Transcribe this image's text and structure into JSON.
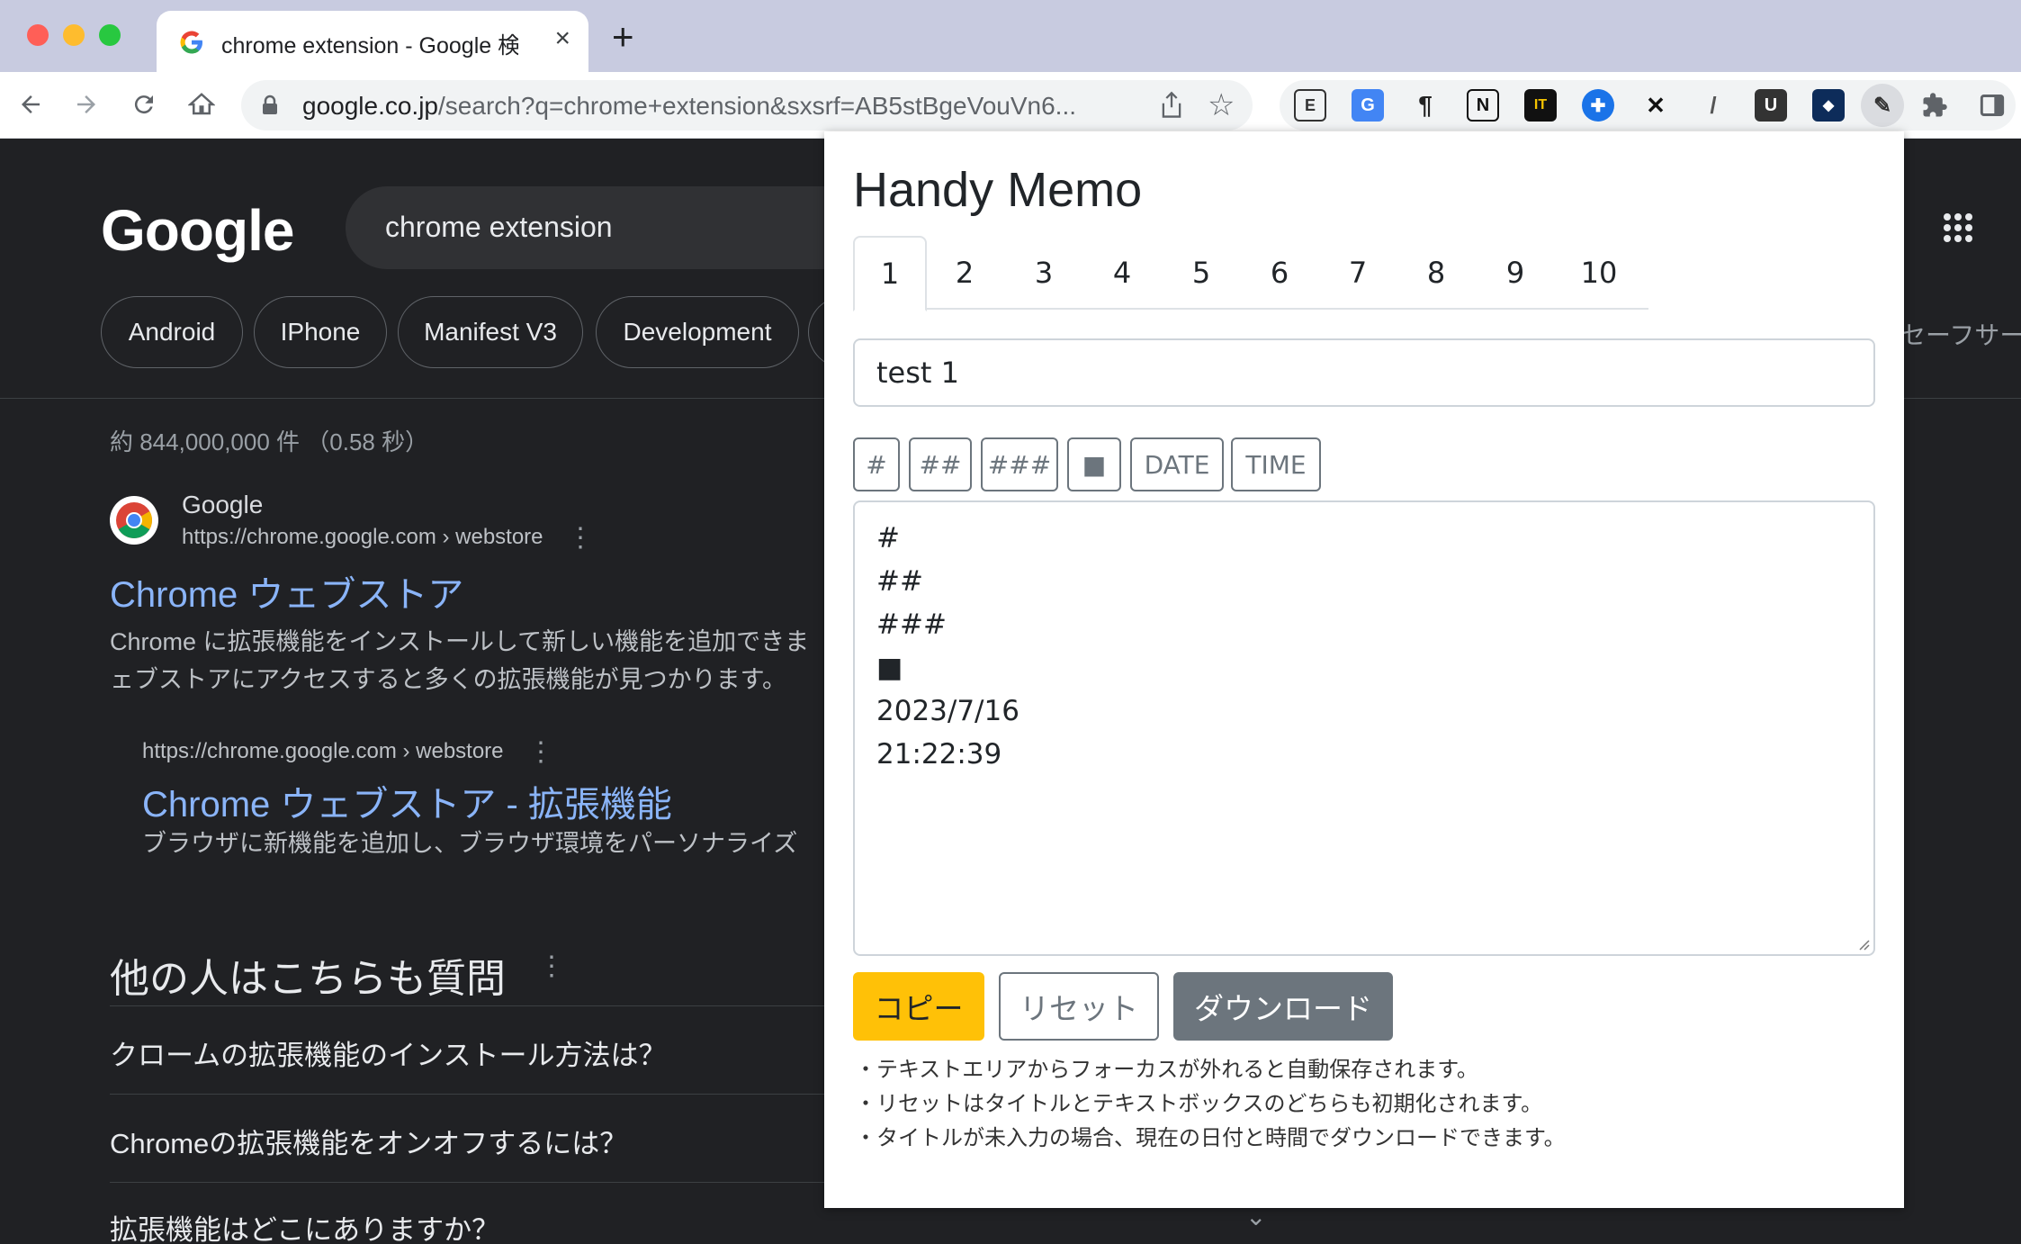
{
  "browser": {
    "tab_title": "chrome extension - Google 検索",
    "tab_close": "×",
    "new_tab": "+",
    "url_host": "google.co.jp",
    "url_rest": "/search?q=chrome+extension&sxsrf=AB5stBgeVouVn6...",
    "extensions": [
      "E",
      "G",
      "¶",
      "N",
      "IT",
      "✚",
      "✕",
      "/",
      "U",
      "◆",
      "✎",
      "puzzle"
    ]
  },
  "google": {
    "logo": "Google",
    "query": "chrome extension",
    "chips": [
      "Android",
      "IPhone",
      "Manifest V3",
      "Development"
    ],
    "safe_search": "セーフサー",
    "result_count": "約 844,000,000 件 （0.58 秒）",
    "result1": {
      "site": "Google",
      "url": "https://chrome.google.com › webstore",
      "title": "Chrome ウェブストア",
      "snippet_line1": "Chrome に拡張機能をインストールして新しい機能を追加できま",
      "snippet_line2": "ェブストアにアクセスすると多くの拡張機能が見つかります。"
    },
    "result2": {
      "url": "https://chrome.google.com › webstore",
      "title": "Chrome ウェブストア - 拡張機能",
      "snippet": "ブラウザに新機能を追加し、ブラウザ環境をパーソナライズ"
    },
    "paa": {
      "title": "他の人はこちらも質問",
      "questions": [
        "クロームの拡張機能のインストール方法は？",
        "Chromeの拡張機能をオンオフするには？",
        "拡張機能はどこにありますか？"
      ]
    }
  },
  "memo": {
    "title": "Handy Memo",
    "tabs": [
      "1",
      "2",
      "3",
      "4",
      "5",
      "6",
      "7",
      "8",
      "9",
      "10"
    ],
    "active_tab": "1",
    "title_value": "test 1",
    "insert_buttons": [
      "#",
      "##",
      "###",
      "■",
      "DATE",
      "TIME"
    ],
    "text_lines": [
      "#",
      "##",
      "###",
      "■",
      "2023/7/16",
      "21:22:39"
    ],
    "buttons": {
      "copy": "コピー",
      "reset": "リセット",
      "download": "ダウンロード"
    },
    "notes": [
      "・テキストエリアからフォーカスが外れると自動保存されます。",
      "・リセットはタイトルとテキストボックスのどちらも初期化されます。",
      "・タイトルが未入力の場合、現在の日付と時間でダウンロードできます。"
    ],
    "colors": {
      "copy_bg": "#ffc107",
      "download_bg": "#6c757d",
      "outline": "#6c757d"
    }
  }
}
